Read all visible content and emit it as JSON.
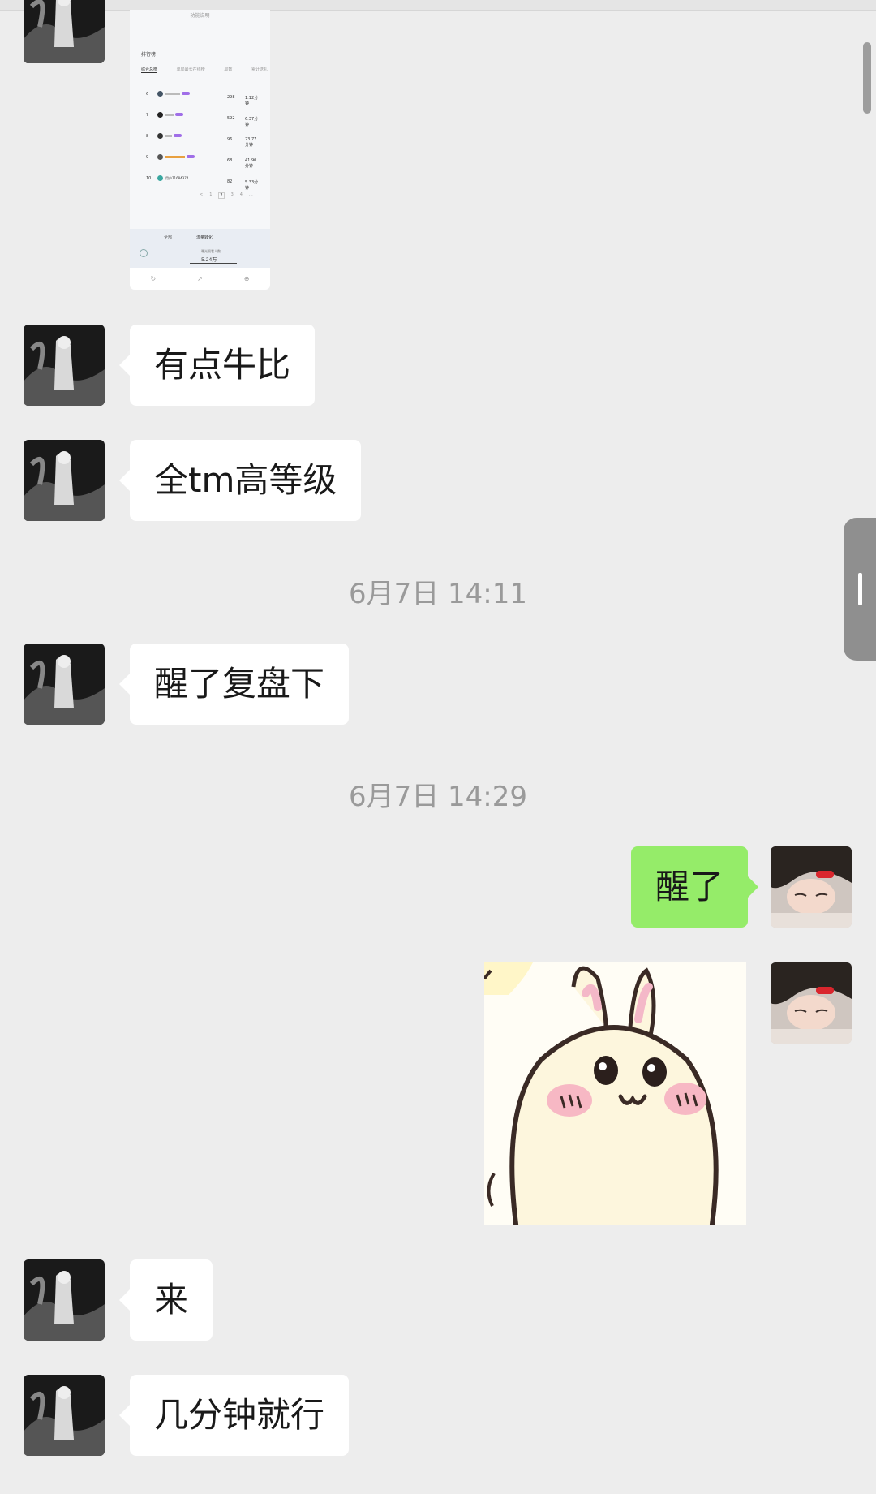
{
  "messages": [
    {
      "side": "left",
      "type": "image",
      "content": "screenshot"
    },
    {
      "side": "left",
      "type": "text",
      "text": "有点牛比"
    },
    {
      "side": "left",
      "type": "text",
      "text": "全tm高等级"
    },
    {
      "type": "timestamp",
      "text": "6月7日 14:11"
    },
    {
      "side": "left",
      "type": "text",
      "text": "醒了复盘下"
    },
    {
      "type": "timestamp",
      "text": "6月7日 14:29"
    },
    {
      "side": "right",
      "type": "text",
      "text": "醒了"
    },
    {
      "side": "right",
      "type": "sticker",
      "content": "bunny-sticker"
    },
    {
      "side": "left",
      "type": "text",
      "text": "来"
    },
    {
      "side": "left",
      "type": "text",
      "text": "几分钟就行"
    }
  ],
  "shared_screenshot": {
    "header": "功能说明",
    "section_title": "排行榜",
    "tabs": [
      "综合总榜",
      "单局最长在线榜",
      "局数",
      "累计送礼"
    ],
    "rows": [
      {
        "rank": "6",
        "stat1": "298",
        "stat2": "1.12分钟"
      },
      {
        "rank": "7",
        "stat1": "592",
        "stat2": "6.37分钟"
      },
      {
        "rank": "8",
        "stat1": "96",
        "stat2": "23.77分钟"
      },
      {
        "rank": "9",
        "stat1": "68",
        "stat2": "41.90分钟"
      },
      {
        "rank": "10",
        "name": "用户71684374...",
        "stat1": "82",
        "stat2": "5.33分钟"
      }
    ],
    "pagination": [
      "<",
      "1",
      "2",
      "3",
      "4",
      "..."
    ],
    "footer_select": "全部",
    "footer_panel_title": "流量转化",
    "footer_metric_label": "曝光观看人数",
    "footer_metric_value": "5.24万"
  },
  "colors": {
    "background": "#ededed",
    "bubble_left": "#ffffff",
    "bubble_right": "#95ec69",
    "timestamp": "#9a9a9a"
  }
}
